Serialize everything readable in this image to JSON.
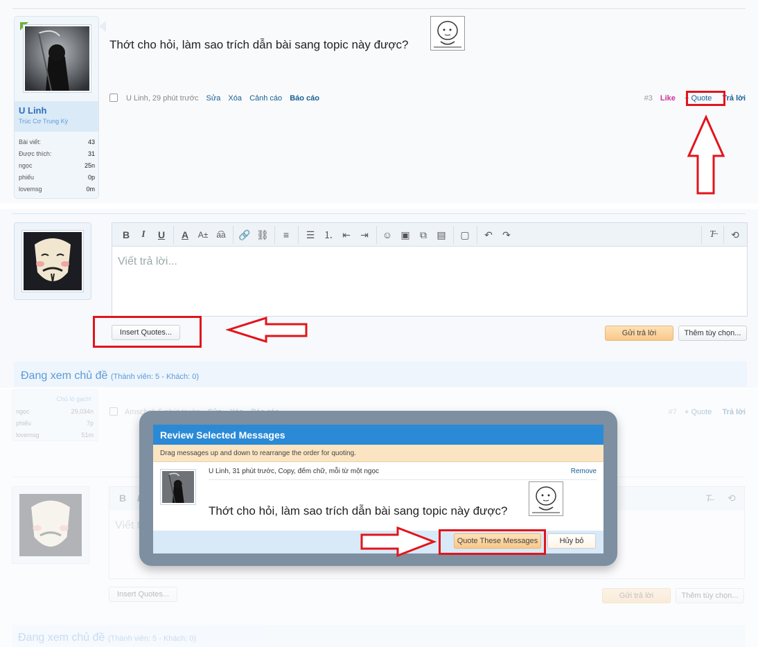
{
  "post": {
    "message": "Thớt cho hỏi, làm sao trích dẫn bài sang topic này được?",
    "author": "U Linh",
    "author_title": "Trúc Cơ Trung Kỳ",
    "meta": "U Linh, 29 phút trước",
    "actions": [
      "Sửa",
      "Xóa",
      "Cảnh cáo",
      "Báo cáo"
    ],
    "number": "#3",
    "like": "Like",
    "quote": "+ Quote",
    "reply": "Trả lời",
    "stats": [
      {
        "label": "Bài viết:",
        "value": "43"
      },
      {
        "label": "Được thích:",
        "value": "31"
      },
      {
        "label": "ngọc",
        "value": "25n"
      },
      {
        "label": "phiếu",
        "value": "0p"
      },
      {
        "label": "lovemsg",
        "value": "0m"
      }
    ]
  },
  "editor": {
    "placeholder": "Viết trả lời...",
    "insert_quotes": "Insert Quotes...",
    "submit": "Gửi trả lời",
    "more_options": "Thêm tùy chọn..."
  },
  "viewing": {
    "title": "Đang xem chủ đề",
    "detail": "(Thành viên: 5 - Khách: 0)"
  },
  "faded": {
    "user_title": "Chủ lò gạch!",
    "stats": [
      {
        "label": "ngọc",
        "value": "29,034n"
      },
      {
        "label": "phiếu",
        "value": "7p"
      },
      {
        "label": "lovemsg",
        "value": "51m"
      }
    ],
    "meta": "Amschel, 5 phút trước",
    "actions": [
      "Sửa",
      "Xóa",
      "Báo cáo"
    ],
    "number": "#7",
    "quote": "+ Quote",
    "reply": "Trả lời",
    "placeholder": "Viết trả",
    "insert_quotes": "Insert Quotes...",
    "submit": "Gửi trả lời",
    "more_options": "Thêm tùy chọn...",
    "viewing_title": "Đang xem chủ đề",
    "viewing_detail": "(Thành viên: 5 - Khách: 0)"
  },
  "modal": {
    "title": "Review Selected Messages",
    "hint": "Drag messages up and down to rearrange the order for quoting.",
    "quote_meta": "U Linh, 31 phút trước, Copy, đếm chữ, mỗi từ một ngọc",
    "remove": "Remove",
    "quote_text": "Thớt cho hỏi, làm sao trích dẫn bài sang topic này được?",
    "quote_button": "Quote These Messages",
    "cancel_button": "Hủy bỏ"
  },
  "colors": {
    "accent_red": "#e3141b",
    "link_blue": "#176093",
    "modal_header": "#2b8ad6",
    "like_pink": "#cc3399"
  }
}
